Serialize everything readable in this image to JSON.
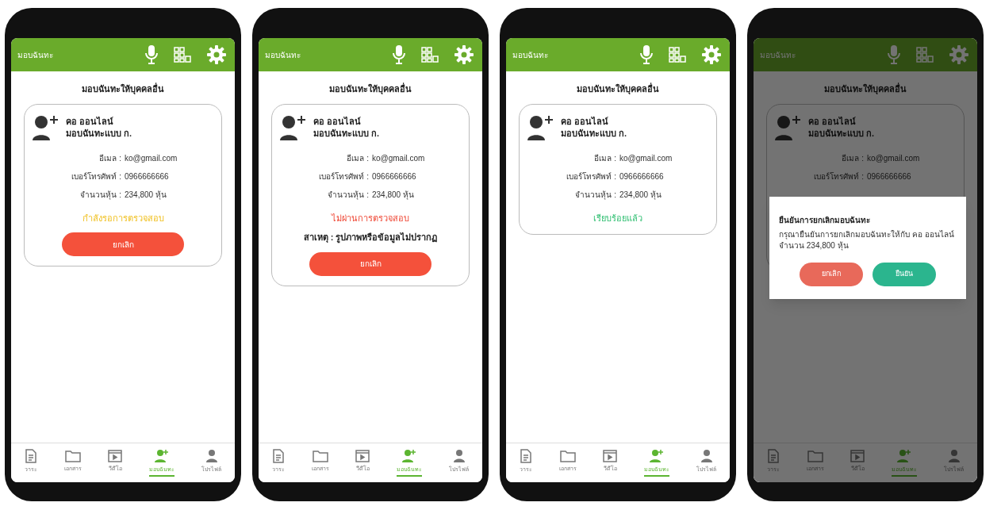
{
  "phones": [
    {
      "header": {
        "title": "มอบฉันทะ"
      },
      "page_title": "มอบฉันทะให้บุคคลอื่น",
      "card": {
        "name": "คอ ออนไลน์",
        "proxy_type": "มอบฉันทะแบบ ก.",
        "fields": [
          {
            "label": "อีเมล :",
            "value": "ko@gmail.com"
          },
          {
            "label": "เบอร์โทรศัพท์ :",
            "value": "0966666666"
          },
          {
            "label": "จำนวนหุ้น :",
            "value": "234,800 หุ้น"
          }
        ],
        "status": {
          "kind": "pending",
          "text": "กำลังรอการตรวจสอบ"
        },
        "button": "ยกเลิก"
      },
      "nav": [
        {
          "label": "วาระ",
          "selected": false
        },
        {
          "label": "เอกสาร",
          "selected": false
        },
        {
          "label": "วีดีโอ",
          "selected": false
        },
        {
          "label": "มอบฉันทะ",
          "selected": true
        },
        {
          "label": "โปรไฟล์",
          "selected": false
        }
      ],
      "dimmed": false
    },
    {
      "header": {
        "title": "มอบฉันทะ"
      },
      "page_title": "มอบฉันทะให้บุคคลอื่น",
      "card": {
        "name": "คอ ออนไลน์",
        "proxy_type": "มอบฉันทะแบบ ก.",
        "fields": [
          {
            "label": "อีเมล :",
            "value": "ko@gmail.com"
          },
          {
            "label": "เบอร์โทรศัพท์ :",
            "value": "0966666666"
          },
          {
            "label": "จำนวนหุ้น :",
            "value": "234,800 หุ้น"
          }
        ],
        "status": {
          "kind": "rejected",
          "text": "ไม่ผ่านการตรวจสอบ"
        },
        "reason": "สาเหตุ : รูปภาพหรือข้อมูลไม่ปรากฏ",
        "button": "ยกเลิก"
      },
      "nav": [
        {
          "label": "วาระ",
          "selected": false
        },
        {
          "label": "เอกสาร",
          "selected": false
        },
        {
          "label": "วีดีโอ",
          "selected": false
        },
        {
          "label": "มอบฉันทะ",
          "selected": true
        },
        {
          "label": "โปรไฟล์",
          "selected": false
        }
      ],
      "dimmed": false
    },
    {
      "header": {
        "title": "มอบฉันทะ"
      },
      "page_title": "มอบฉันทะให้บุคคลอื่น",
      "card": {
        "name": "คอ ออนไลน์",
        "proxy_type": "มอบฉันทะแบบ ก.",
        "fields": [
          {
            "label": "อีเมล :",
            "value": "ko@gmail.com"
          },
          {
            "label": "เบอร์โทรศัพท์ :",
            "value": "0966666666"
          },
          {
            "label": "จำนวนหุ้น :",
            "value": "234,800 หุ้น"
          }
        ],
        "status": {
          "kind": "approved",
          "text": "เรียบร้อยแล้ว"
        }
      },
      "nav": [
        {
          "label": "วาระ",
          "selected": false
        },
        {
          "label": "เอกสาร",
          "selected": false
        },
        {
          "label": "วีดีโอ",
          "selected": false
        },
        {
          "label": "มอบฉันทะ",
          "selected": true
        },
        {
          "label": "โปรไฟล์",
          "selected": false
        }
      ],
      "dimmed": false
    },
    {
      "header": {
        "title": "มอบฉันทะ"
      },
      "page_title": "มอบฉันทะให้บุคคลอื่น",
      "card": {
        "name": "คอ ออนไลน์",
        "proxy_type": "มอบฉันทะแบบ ก.",
        "fields": [
          {
            "label": "อีเมล :",
            "value": "ko@gmail.com"
          },
          {
            "label": "เบอร์โทรศัพท์ :",
            "value": "0966666666"
          }
        ]
      },
      "nav": [
        {
          "label": "วาระ",
          "selected": false
        },
        {
          "label": "เอกสาร",
          "selected": false
        },
        {
          "label": "วีดีโอ",
          "selected": false
        },
        {
          "label": "มอบฉันทะ",
          "selected": true
        },
        {
          "label": "โปรไฟล์",
          "selected": false
        }
      ],
      "dimmed": true,
      "dialog": {
        "title": "ยืนยันการยกเลิกมอบฉันทะ",
        "message": "กรุณายืนยันการยกเลิกมอบฉันทะให้กับ คอ ออนไลน์",
        "amount": "จำนวน 234,800 หุ้น",
        "buttons": [
          {
            "kind": "cancel",
            "label": "ยกเลิก"
          },
          {
            "kind": "confirm",
            "label": "ยืนยัน"
          }
        ]
      }
    }
  ]
}
